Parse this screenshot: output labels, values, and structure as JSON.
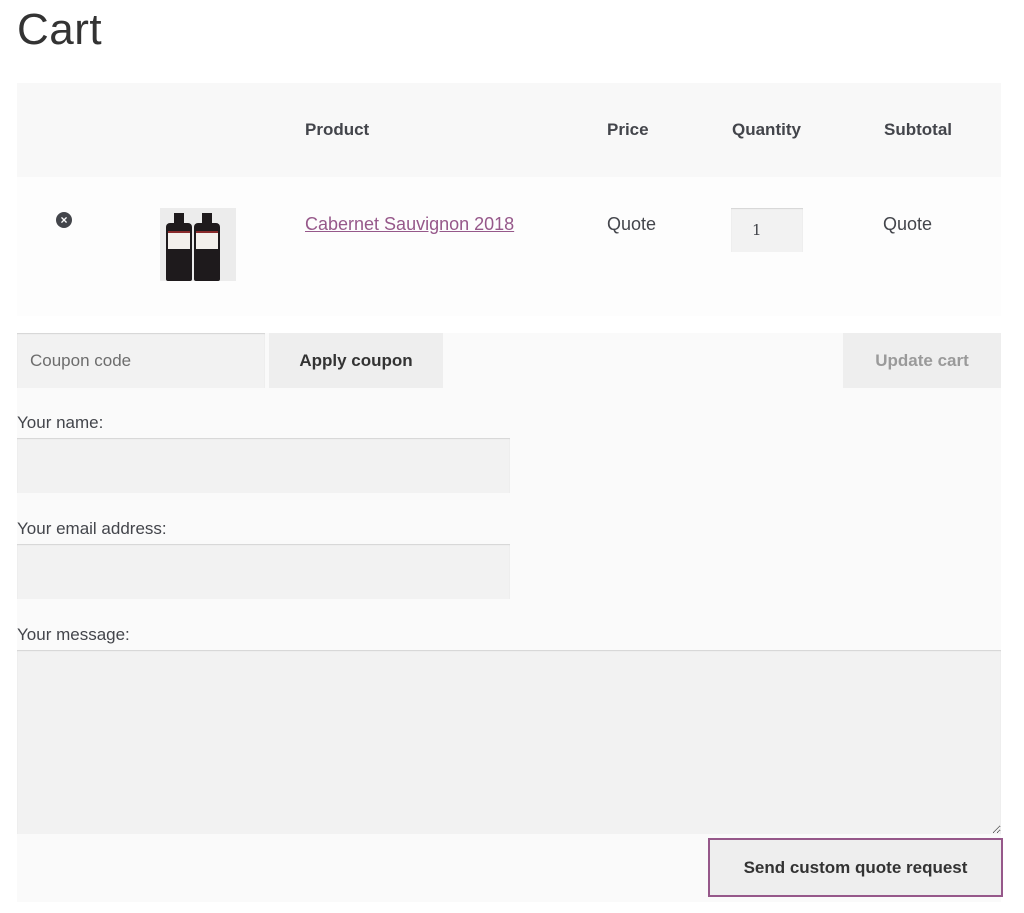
{
  "page": {
    "title": "Cart"
  },
  "table": {
    "headers": {
      "product": "Product",
      "price": "Price",
      "quantity": "Quantity",
      "subtotal": "Subtotal"
    },
    "rows": [
      {
        "name": "Cabernet Sauvignon 2018",
        "price": "Quote",
        "quantity": "1",
        "subtotal": "Quote",
        "remove_icon": "remove-circle-icon"
      }
    ]
  },
  "actions": {
    "coupon_placeholder": "Coupon code",
    "apply_coupon": "Apply coupon",
    "update_cart": "Update cart"
  },
  "form": {
    "name_label": "Your name:",
    "email_label": "Your email address:",
    "message_label": "Your message:",
    "submit": "Send custom quote request"
  },
  "colors": {
    "accent": "#96588a",
    "text": "#43454b"
  }
}
